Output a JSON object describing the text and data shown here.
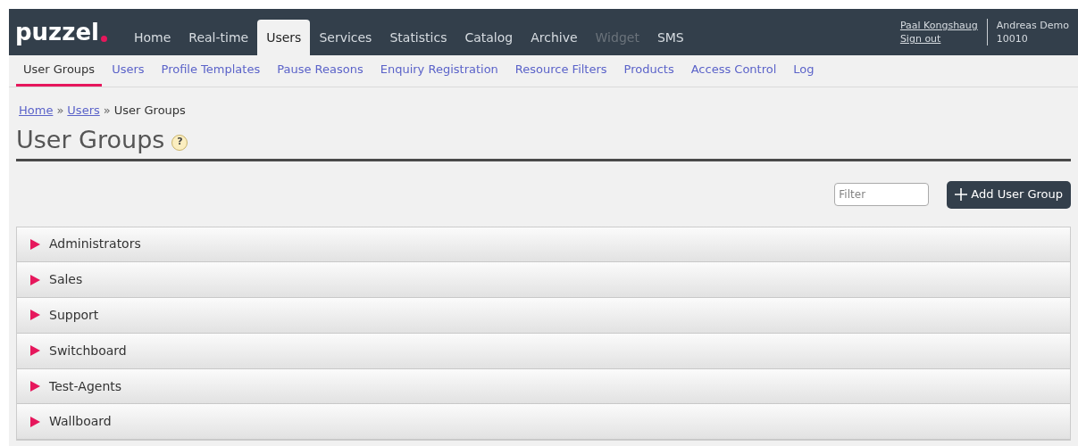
{
  "header": {
    "logo": "puzzel",
    "main_tabs": [
      {
        "label": "Home",
        "selected": false,
        "disabled": false
      },
      {
        "label": "Real-time",
        "selected": false,
        "disabled": false
      },
      {
        "label": "Users",
        "selected": true,
        "disabled": false
      },
      {
        "label": "Services",
        "selected": false,
        "disabled": false
      },
      {
        "label": "Statistics",
        "selected": false,
        "disabled": false
      },
      {
        "label": "Catalog",
        "selected": false,
        "disabled": false
      },
      {
        "label": "Archive",
        "selected": false,
        "disabled": false
      },
      {
        "label": "Widget",
        "selected": false,
        "disabled": true
      },
      {
        "label": "SMS",
        "selected": false,
        "disabled": false
      }
    ],
    "user": {
      "name": "Paal Kongshaug",
      "sign_out": "Sign out",
      "account": "Andreas Demo",
      "account_id": "10010"
    }
  },
  "sub_tabs": [
    {
      "label": "User Groups",
      "selected": true
    },
    {
      "label": "Users",
      "selected": false
    },
    {
      "label": "Profile Templates",
      "selected": false
    },
    {
      "label": "Pause Reasons",
      "selected": false
    },
    {
      "label": "Enquiry Registration",
      "selected": false
    },
    {
      "label": "Resource Filters",
      "selected": false
    },
    {
      "label": "Products",
      "selected": false
    },
    {
      "label": "Access Control",
      "selected": false
    },
    {
      "label": "Log",
      "selected": false
    }
  ],
  "breadcrumb": {
    "links": [
      "Home",
      "Users"
    ],
    "separator": "»",
    "current": "User Groups"
  },
  "page_title": "User Groups",
  "help_icon": "?",
  "filter": {
    "placeholder": "Filter"
  },
  "add_button": "Add User Group",
  "groups": [
    {
      "name": "Administrators",
      "expanded": false
    },
    {
      "name": "Sales",
      "expanded": false
    },
    {
      "name": "Support",
      "expanded": false
    },
    {
      "name": "Switchboard",
      "expanded": false
    },
    {
      "name": "Test-Agents",
      "expanded": false
    },
    {
      "name": "Wallboard",
      "expanded": false
    }
  ]
}
